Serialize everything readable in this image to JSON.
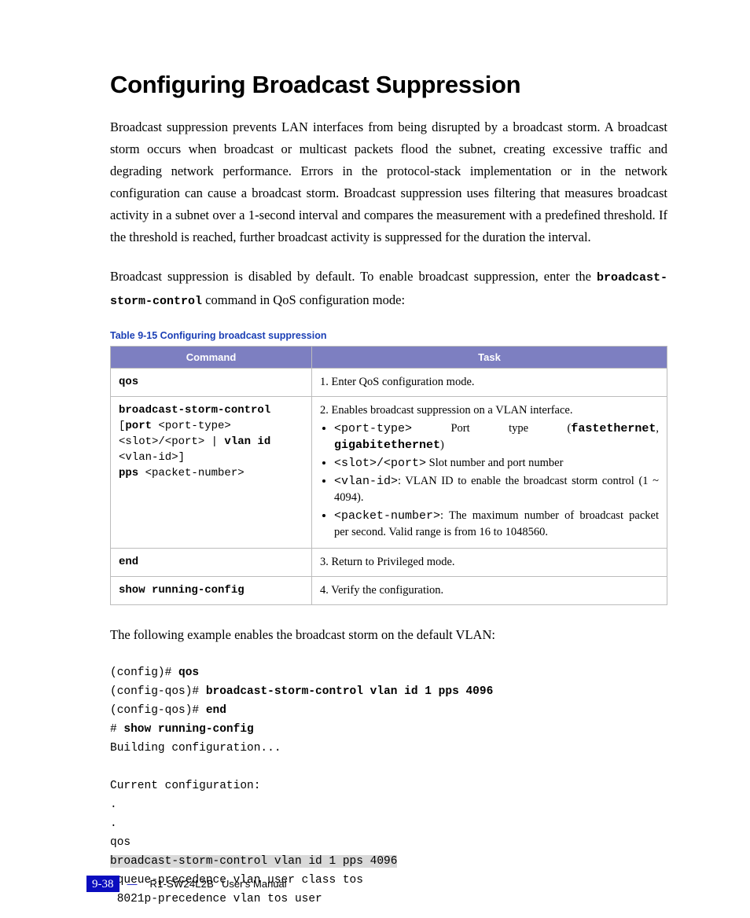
{
  "heading": "Configuring Broadcast Suppression",
  "para1": "Broadcast suppression prevents LAN interfaces from being disrupted by a broadcast storm. A broadcast storm occurs when broadcast or multicast packets flood the subnet, creating excessive traffic and degrading network performance. Errors in the protocol-stack implementation or in the network configuration can cause a broadcast storm. Broadcast suppression uses filtering that measures broadcast activity in a subnet over a 1-second interval and compares the measurement with a predefined threshold. If the threshold is reached, further broadcast activity is suppressed for the duration the interval.",
  "para2_pre": "Broadcast suppression is disabled by default. To enable broadcast suppression, enter the ",
  "para2_cmd": "broadcast-storm-control",
  "para2_post": " command in QoS configuration mode:",
  "table_caption": "Table 9-15   Configuring broadcast suppression",
  "th_command": "Command",
  "th_task": "Task",
  "rows": {
    "r1": {
      "cmd": "qos",
      "task": "1. Enter QoS configuration mode."
    },
    "r2": {
      "cmd_l1b": "broadcast-storm-control",
      "cmd_l2a": "[",
      "cmd_l2b": "port",
      "cmd_l2c": " <port-type>",
      "cmd_l3": "<slot>/<port> | ",
      "cmd_l3b": "vlan id",
      "cmd_l4": "<vlan-id>]",
      "cmd_l5b": "pps",
      "cmd_l5": " <packet-number>",
      "task_lead": "2. Enables broadcast suppression on a VLAN interface.",
      "b1_a": "<port-type>",
      "b1_b": " Port type (",
      "b1_c": "fastethernet",
      "b1_d": ", ",
      "b1_e": "gigabitethernet",
      "b1_f": ")",
      "b2_a": "<slot>/<port>",
      "b2_b": " Slot number and port number",
      "b3_a": "<vlan-id>",
      "b3_b": ": VLAN ID to enable the broadcast storm control (1 ~ 4094).",
      "b4_a": "<packet-number>",
      "b4_b": ": The maximum number of broadcast packet per second. Valid range is from 16 to 1048560."
    },
    "r3": {
      "cmd": "end",
      "task": "3. Return to Privileged mode."
    },
    "r4": {
      "cmd": "show running-config",
      "task": "4. Verify the configuration."
    }
  },
  "para3": "The following example enables the broadcast storm on the default VLAN:",
  "code": {
    "l1a": "(config)# ",
    "l1b": "qos",
    "l2a": "(config-qos)# ",
    "l2b": "broadcast-storm-control vlan id 1 pps 4096",
    "l3a": "(config-qos)# ",
    "l3b": "end",
    "l4a": "# ",
    "l4b": "show running-config",
    "l5": "Building configuration...",
    "l6": "",
    "l7": "Current configuration:",
    "l8": ".",
    "l9": ".",
    "l10": "qos",
    "l11": "broadcast-storm-control vlan id 1 pps 4096",
    "l12": " queue-precedence vlan user class tos",
    "l13": " 8021p-precedence vlan tos user"
  },
  "footer": {
    "page": "9-38",
    "sep": "—",
    "doc_code": "R1-SW24L2B",
    "doc_title": "User's Manual"
  }
}
